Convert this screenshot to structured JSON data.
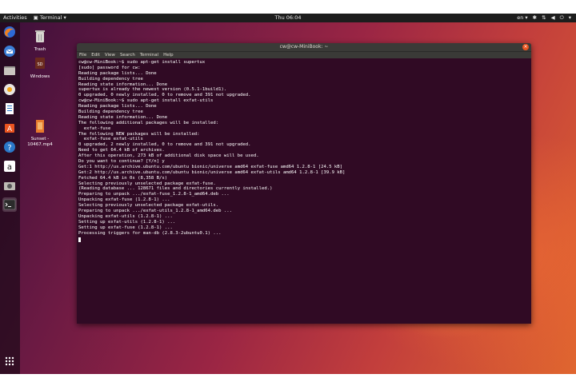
{
  "topbar": {
    "activities": "Activities",
    "app_menu": "Terminal",
    "clock": "Thu 06:04",
    "lang": "en"
  },
  "desktop": {
    "icons": [
      {
        "label": "Trash"
      },
      {
        "label": "Windows"
      },
      {
        "label": "Sunset -\n10467.mp4"
      }
    ]
  },
  "window": {
    "title": "cw@cw-MiniBook: ~",
    "menu": [
      "File",
      "Edit",
      "View",
      "Search",
      "Terminal",
      "Help"
    ],
    "close_glyph": "×"
  },
  "terminal": {
    "lines": [
      "cw@cw-MiniBook:~$ sudo apt-get install supertux",
      "[sudo] password for cw:",
      "Reading package lists... Done",
      "Building dependency tree",
      "Reading state information... Done",
      "supertux is already the newest version (0.5.1-1build1).",
      "0 upgraded, 0 newly installed, 0 to remove and 391 not upgraded.",
      "cw@cw-MiniBook:~$ sudo apt-get install exfat-utils",
      "Reading package lists... Done",
      "Building dependency tree",
      "Reading state information... Done",
      "The following additional packages will be installed:",
      "  exfat-fuse",
      "The following NEW packages will be installed:",
      "  exfat-fuse exfat-utils",
      "0 upgraded, 2 newly installed, 0 to remove and 391 not upgraded.",
      "Need to get 64.4 kB of archives.",
      "After this operation, 273 kB of additional disk space will be used.",
      "Do you want to continue? [Y/n] y",
      "Get:1 http://us.archive.ubuntu.com/ubuntu bionic/universe amd64 exfat-fuse amd64 1.2.8-1 [24.5 kB]",
      "Get:2 http://us.archive.ubuntu.com/ubuntu bionic/universe amd64 exfat-utils amd64 1.2.8-1 [39.9 kB]",
      "Fetched 64.4 kB in 0s (8,358 B/s)",
      "Selecting previously unselected package exfat-fuse.",
      "(Reading database ... 128671 files and directories currently installed.)",
      "Preparing to unpack .../exfat-fuse_1.2.8-1_amd64.deb ...",
      "Unpacking exfat-fuse (1.2.8-1) ...",
      "Selecting previously unselected package exfat-utils.",
      "Preparing to unpack .../exfat-utils_1.2.8-1_amd64.deb ...",
      "Unpacking exfat-utils (1.2.8-1) ...",
      "Setting up exfat-utils (1.2.8-1) ...",
      "Setting up exfat-fuse (1.2.8-1) ...",
      "Processing triggers for man-db (2.8.3-2ubuntu0.1) ..."
    ]
  },
  "colors": {
    "terminal_bg": "#300a24",
    "accent": "#e95420"
  }
}
